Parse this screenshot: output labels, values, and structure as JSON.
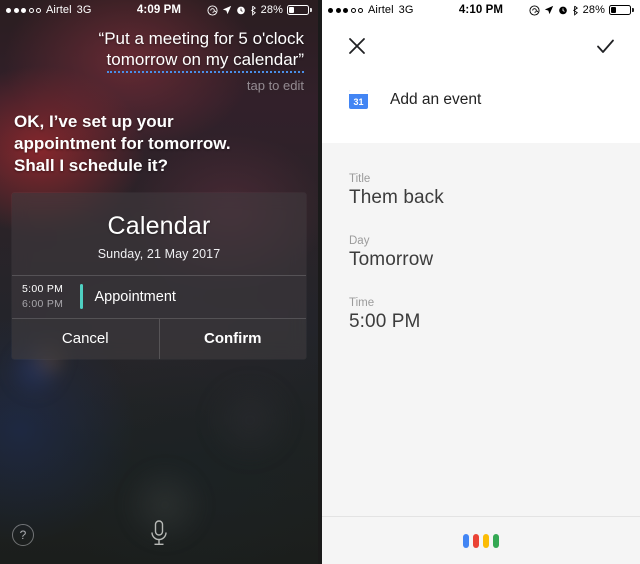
{
  "colors": {
    "assistant_blue": "#4285f4",
    "assistant_red": "#ea4335",
    "assistant_yellow": "#fbbc05",
    "assistant_green": "#34a853",
    "calendar_accent": "#4fd0c2",
    "siri_link_underline": "#4a8fe8"
  },
  "siri": {
    "status_bar": {
      "signal_filled": 3,
      "signal_empty": 2,
      "carrier": "Airtel",
      "network": "3G",
      "time": "4:09 PM",
      "battery_percent": "28%",
      "icons": [
        "rotation-lock-icon",
        "location-arrow-icon",
        "alarm-clock-icon",
        "bluetooth-icon"
      ]
    },
    "query": {
      "line1": "“Put a meeting for 5 o'clock",
      "line2": "tomorrow on my calendar”",
      "edit_hint": "tap to edit"
    },
    "answer": {
      "line1": "OK, I’ve set up your",
      "line2": "appointment for tomorrow.",
      "line3": "Shall I schedule it?"
    },
    "card": {
      "title": "Calendar",
      "date": "Sunday, 21 May 2017",
      "event": {
        "start_time": "5:00 PM",
        "end_time": "6:00 PM",
        "title": "Appointment"
      },
      "cancel_label": "Cancel",
      "confirm_label": "Confirm"
    },
    "bottom": {
      "help_label": "?",
      "mic_icon": "microphone-icon"
    }
  },
  "assistant": {
    "status_bar": {
      "signal_filled": 3,
      "signal_empty": 2,
      "carrier": "Airtel",
      "network": "3G",
      "time": "4:10 PM",
      "battery_percent": "28%",
      "icons": [
        "rotation-lock-icon",
        "location-arrow-icon",
        "alarm-clock-icon",
        "bluetooth-icon"
      ]
    },
    "actions": {
      "close_label": "close-icon",
      "confirm_label": "check-icon"
    },
    "header": {
      "calendar_day": "31",
      "label": "Add an event"
    },
    "fields": [
      {
        "label": "Title",
        "value": "Them back"
      },
      {
        "label": "Day",
        "value": "Tomorrow"
      },
      {
        "label": "Time",
        "value": "5:00 PM"
      }
    ],
    "mic_bar": {
      "dots": [
        "#4285f4",
        "#ea4335",
        "#fbbc05",
        "#34a853"
      ]
    }
  }
}
